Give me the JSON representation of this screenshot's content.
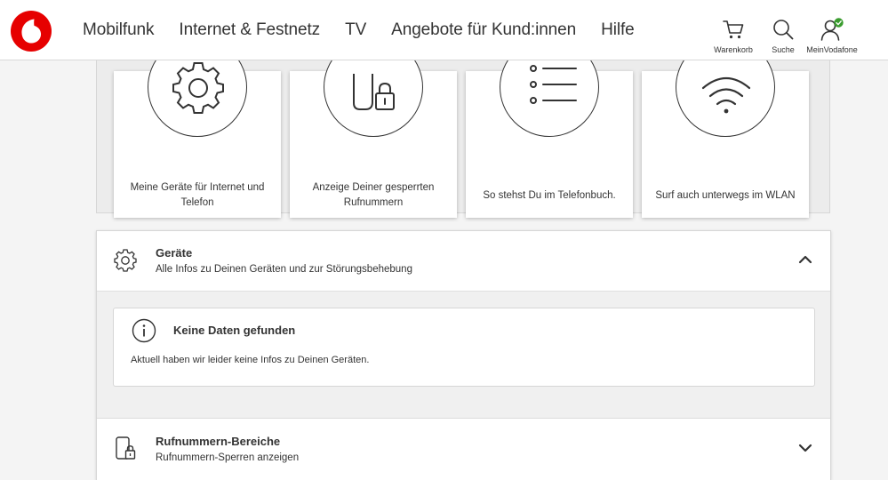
{
  "nav": {
    "items": [
      "Mobilfunk",
      "Internet & Festnetz",
      "TV",
      "Angebote für Kund:innen",
      "Hilfe"
    ]
  },
  "header_icons": {
    "cart_label": "Warenkorb",
    "search_label": "Suche",
    "account_label": "MeinVodafone"
  },
  "tiles": [
    {
      "icon": "gear-icon",
      "label": "Meine Geräte für Internet und Telefon"
    },
    {
      "icon": "locked-phone-icon",
      "label": "Anzeige Deiner gesperrten Rufnummern"
    },
    {
      "icon": "list-icon",
      "label": "So stehst Du im Telefonbuch."
    },
    {
      "icon": "wifi-icon",
      "label": "Surf auch unterwegs im WLAN"
    }
  ],
  "sections": [
    {
      "icon": "gear-icon",
      "title": "Geräte",
      "subtitle": "Alle Infos zu Deinen Geräten und zur Störungsbehebung",
      "expanded": true,
      "notice": {
        "icon": "info-icon",
        "title": "Keine Daten gefunden",
        "text": "Aktuell haben wir leider keine Infos zu Deinen Geräten."
      }
    },
    {
      "icon": "locked-phone-icon",
      "title": "Rufnummern-Bereiche",
      "subtitle": "Rufnummern-Sperren anzeigen",
      "expanded": false
    }
  ],
  "colors": {
    "brand_red": "#e60000",
    "account_check": "#3a9c2e",
    "text": "#333333"
  }
}
